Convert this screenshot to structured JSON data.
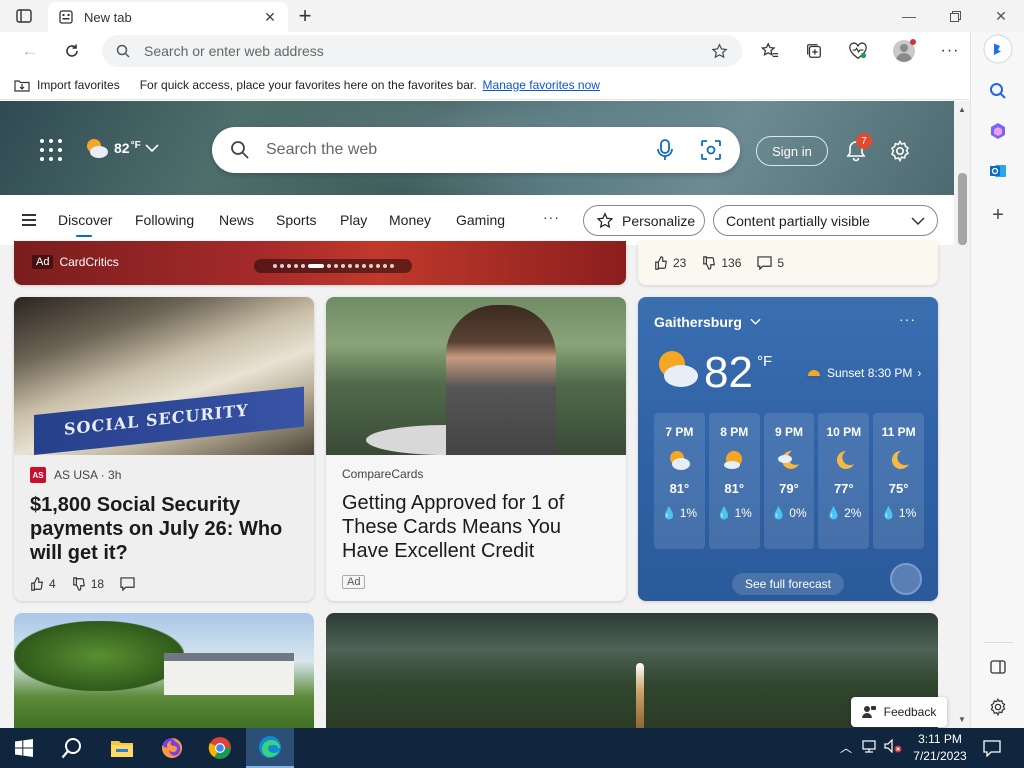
{
  "browser": {
    "tab_title": "New tab",
    "address_placeholder": "Search or enter web address"
  },
  "favorites_bar": {
    "import_label": "Import favorites",
    "message": "For quick access, place your favorites here on the favorites bar.",
    "manage_link": "Manage favorites now"
  },
  "hero": {
    "weather_temp": "82",
    "weather_unit": "°F",
    "search_placeholder": "Search the web",
    "signin_label": "Sign in",
    "notification_count": "7"
  },
  "categories": [
    "Discover",
    "Following",
    "News",
    "Sports",
    "Play",
    "Money",
    "Gaming"
  ],
  "more_label": "···",
  "personalize_label": "Personalize",
  "visibility_label": "Content partially visible",
  "top_ad": {
    "tag": "Ad",
    "sponsor": "CardCritics"
  },
  "top_right_reactions": {
    "likes": "23",
    "dislikes": "136",
    "comments": "5"
  },
  "article1": {
    "source": "AS USA · 3h",
    "logo_text": "AS",
    "image_text": "SOCIAL SECURITY",
    "headline": "$1,800 Social Security payments on July 26: Who will get it?",
    "likes": "4",
    "dislikes": "18"
  },
  "article2": {
    "source": "CompareCards",
    "headline": "Getting Approved for 1 of These Cards Means You Have Excellent Credit",
    "ad_tag": "Ad"
  },
  "weather": {
    "location": "Gaithersburg",
    "more": "···",
    "temp": "82",
    "unit": "°F",
    "sunset": "Sunset 8:30 PM",
    "hours": [
      {
        "time": "7 PM",
        "temp": "81°",
        "precip": "1%",
        "icon": "partly-cloudy-icon"
      },
      {
        "time": "8 PM",
        "temp": "81°",
        "precip": "1%",
        "icon": "sun-cloud-icon"
      },
      {
        "time": "9 PM",
        "temp": "79°",
        "precip": "0%",
        "icon": "moon-cloud-icon"
      },
      {
        "time": "10 PM",
        "temp": "77°",
        "precip": "2%",
        "icon": "moon-icon"
      },
      {
        "time": "11 PM",
        "temp": "75°",
        "precip": "1%",
        "icon": "moon-icon"
      }
    ],
    "forecast_label": "See full forecast"
  },
  "feedback_label": "Feedback",
  "taskbar": {
    "time": "3:11 PM",
    "date": "7/21/2023"
  },
  "colors": {
    "accent": "#0f6cbd",
    "taskbar": "#10253e",
    "weather_card": "#2f62a6",
    "badge": "#e24a2f"
  }
}
